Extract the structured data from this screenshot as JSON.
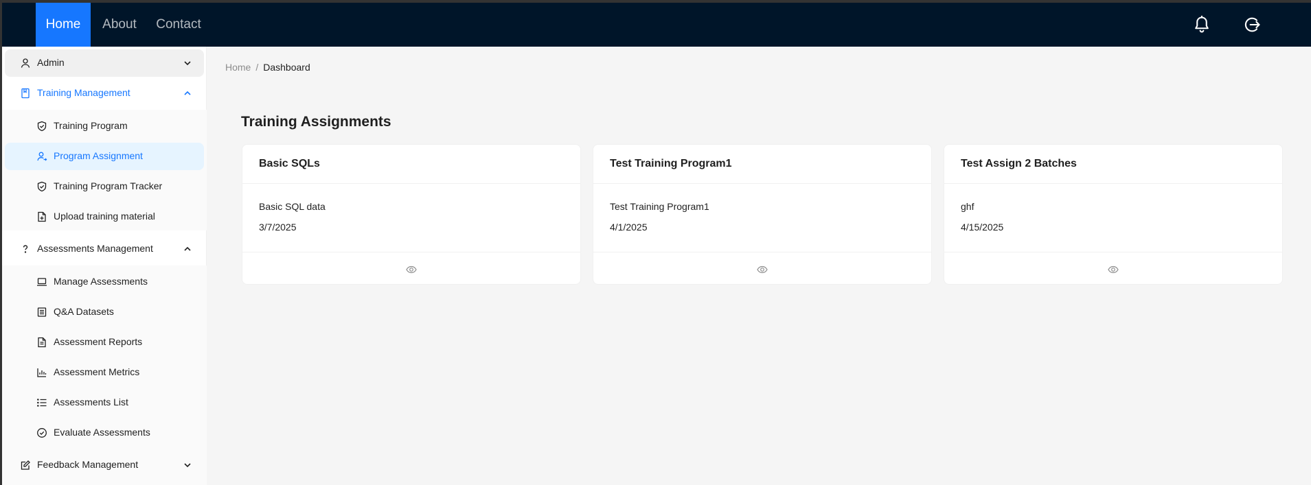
{
  "topnav": {
    "items": [
      {
        "label": "Home",
        "active": true
      },
      {
        "label": "About",
        "active": false
      },
      {
        "label": "Contact",
        "active": false
      }
    ],
    "icons": [
      "bell-icon",
      "logout-icon"
    ]
  },
  "sidebar": {
    "admin": {
      "label": "Admin",
      "icon": "user-icon",
      "state": "collapsed"
    },
    "training": {
      "label": "Training Management",
      "icon": "book-icon",
      "state": "expanded",
      "items": [
        {
          "label": "Training Program",
          "icon": "shield-check-icon"
        },
        {
          "label": "Program Assignment",
          "icon": "user-switch-icon",
          "selected": true
        },
        {
          "label": "Training Program Tracker",
          "icon": "shield-check-icon"
        },
        {
          "label": "Upload training material",
          "icon": "file-add-icon"
        }
      ]
    },
    "assessments": {
      "label": "Assessments Management",
      "icon": "question-icon",
      "state": "expanded",
      "items": [
        {
          "label": "Manage Assessments",
          "icon": "laptop-icon"
        },
        {
          "label": "Q&A Datasets",
          "icon": "database-icon"
        },
        {
          "label": "Assessment Reports",
          "icon": "file-text-icon"
        },
        {
          "label": "Assessment Metrics",
          "icon": "bar-chart-icon"
        },
        {
          "label": "Assessments List",
          "icon": "list-icon"
        },
        {
          "label": "Evaluate Assessments",
          "icon": "check-circle-icon"
        }
      ]
    },
    "feedback": {
      "label": "Feedback Management",
      "icon": "edit-icon",
      "state": "collapsed"
    }
  },
  "breadcrumb": {
    "home": "Home",
    "separator": "/",
    "current": "Dashboard"
  },
  "page": {
    "title": "Training Assignments"
  },
  "cards": [
    {
      "title": "Basic SQLs",
      "description": "Basic SQL data",
      "date": "3/7/2025",
      "action_icon": "eye-icon"
    },
    {
      "title": "Test Training Program1",
      "description": "Test Training Program1",
      "date": "4/1/2025",
      "action_icon": "eye-icon"
    },
    {
      "title": "Test Assign 2 Batches",
      "description": "ghf",
      "date": "4/15/2025",
      "action_icon": "eye-icon"
    }
  ],
  "colors": {
    "header_bg": "#001529",
    "accent": "#1677ff",
    "selected_bg": "#e6f4ff",
    "content_bg": "#f5f5f5"
  }
}
